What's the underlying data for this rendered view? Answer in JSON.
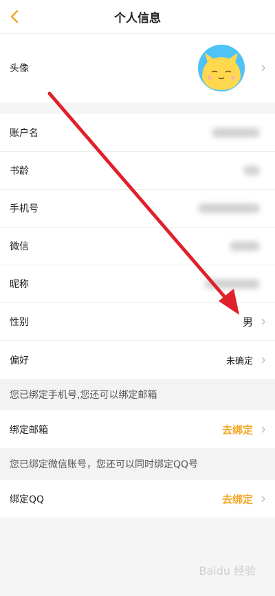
{
  "header": {
    "title": "个人信息"
  },
  "profile": {
    "avatar_label": "头像",
    "avatar_bg": "#4fc3f7",
    "avatar_face": "#ffd84d"
  },
  "info_rows": [
    {
      "label": "账户名"
    },
    {
      "label": "书龄"
    },
    {
      "label": "手机号"
    },
    {
      "label": "微信"
    },
    {
      "label": "昵称"
    },
    {
      "label": "性别",
      "value": "男"
    },
    {
      "label": "偏好",
      "value": "未确定"
    }
  ],
  "email_hint": "您已绑定手机号,您还可以绑定邮箱",
  "bind_email": {
    "label": "绑定邮箱",
    "action": "去绑定"
  },
  "qq_hint": "您已绑定微信账号，您还可以同时绑定QQ号",
  "bind_qq": {
    "label": "绑定QQ",
    "action": "去绑定"
  },
  "colors": {
    "accent": "#f5a623",
    "arrow": "#e0212b"
  },
  "watermark": "Baidu 经验"
}
